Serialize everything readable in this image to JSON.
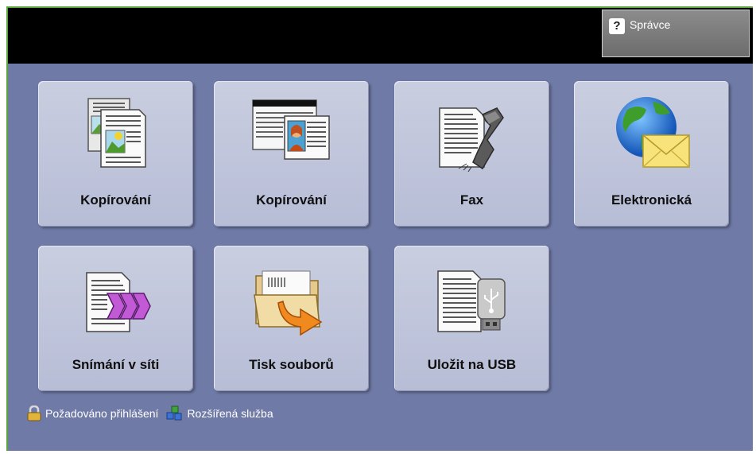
{
  "header": {
    "admin_label": "Správce",
    "admin_icon": "question-mark-icon"
  },
  "tiles": [
    {
      "label": "Kopírování",
      "icon": "copy-document-icon"
    },
    {
      "label": "Kopírování",
      "icon": "id-card-copy-icon"
    },
    {
      "label": "Fax",
      "icon": "fax-icon"
    },
    {
      "label": "Elektronická",
      "icon": "email-globe-icon"
    },
    {
      "label": "Snímání v síti",
      "icon": "network-scan-icon"
    },
    {
      "label": "Tisk souborů",
      "icon": "print-folder-icon"
    },
    {
      "label": "Uložit na USB",
      "icon": "usb-save-icon"
    }
  ],
  "legend": {
    "login_required": "Požadováno přihlášení",
    "extended_service": "Rozšířená služba"
  },
  "colors": {
    "background": "#6f7aa6",
    "tile": "#c0c5dc",
    "frame_border": "#5aa63a"
  }
}
